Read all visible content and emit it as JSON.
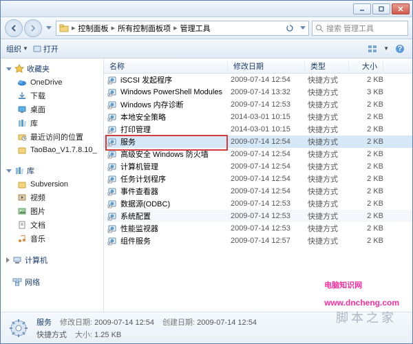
{
  "breadcrumb": {
    "l1": "控制面板",
    "l2": "所有控制面板项",
    "l3": "管理工具"
  },
  "search": {
    "placeholder": "搜索 管理工具"
  },
  "toolbar": {
    "organize": "组织",
    "open": "打开"
  },
  "sidebar": {
    "favorites": {
      "label": "收藏夹",
      "items": [
        {
          "label": "OneDrive"
        },
        {
          "label": "下载"
        },
        {
          "label": "桌面"
        },
        {
          "label": "库"
        },
        {
          "label": "最近访问的位置"
        },
        {
          "label": "TaoBao_V1.7.8.10_"
        }
      ]
    },
    "libraries": {
      "label": "库",
      "items": [
        {
          "label": "Subversion"
        },
        {
          "label": "视频"
        },
        {
          "label": "图片"
        },
        {
          "label": "文档"
        },
        {
          "label": "音乐"
        }
      ]
    },
    "computer": {
      "label": "计算机"
    },
    "network": {
      "label": "网络"
    }
  },
  "columns": {
    "name": "名称",
    "date": "修改日期",
    "type": "类型",
    "size": "大小"
  },
  "files": [
    {
      "name": "iSCSI 发起程序",
      "date": "2009-07-14 12:54",
      "type": "快捷方式",
      "size": "2 KB"
    },
    {
      "name": "Windows PowerShell Modules",
      "date": "2009-07-14 13:32",
      "type": "快捷方式",
      "size": "3 KB"
    },
    {
      "name": "Windows 内存诊断",
      "date": "2009-07-14 12:53",
      "type": "快捷方式",
      "size": "2 KB"
    },
    {
      "name": "本地安全策略",
      "date": "2014-03-01 10:15",
      "type": "快捷方式",
      "size": "2 KB"
    },
    {
      "name": "打印管理",
      "date": "2014-03-01 10:15",
      "type": "快捷方式",
      "size": "2 KB"
    },
    {
      "name": "服务",
      "date": "2009-07-14 12:54",
      "type": "快捷方式",
      "size": "2 KB",
      "selected": true,
      "highlight": true
    },
    {
      "name": "高级安全 Windows 防火墙",
      "date": "2009-07-14 12:54",
      "type": "快捷方式",
      "size": "2 KB"
    },
    {
      "name": "计算机管理",
      "date": "2009-07-14 12:54",
      "type": "快捷方式",
      "size": "2 KB"
    },
    {
      "name": "任务计划程序",
      "date": "2009-07-14 12:54",
      "type": "快捷方式",
      "size": "2 KB"
    },
    {
      "name": "事件查看器",
      "date": "2009-07-14 12:54",
      "type": "快捷方式",
      "size": "2 KB"
    },
    {
      "name": "数据源(ODBC)",
      "date": "2009-07-14 12:53",
      "type": "快捷方式",
      "size": "2 KB"
    },
    {
      "name": "系统配置",
      "date": "2009-07-14 12:53",
      "type": "快捷方式",
      "size": "2 KB",
      "light": true
    },
    {
      "name": "性能监视器",
      "date": "2009-07-14 12:53",
      "type": "快捷方式",
      "size": "2 KB"
    },
    {
      "name": "组件服务",
      "date": "2009-07-14 12:57",
      "type": "快捷方式",
      "size": "2 KB"
    }
  ],
  "details": {
    "name": "服务",
    "type_label": "快捷方式",
    "mod_k": "修改日期:",
    "mod_v": "2009-07-14 12:54",
    "size_k": "大小:",
    "size_v": "1.25 KB",
    "create_k": "创建日期:",
    "create_v": "2009-07-14 12:54"
  },
  "watermark": {
    "text1": "电脑知识网",
    "url": "www.dncheng.com",
    "text2": "脚本之家"
  }
}
